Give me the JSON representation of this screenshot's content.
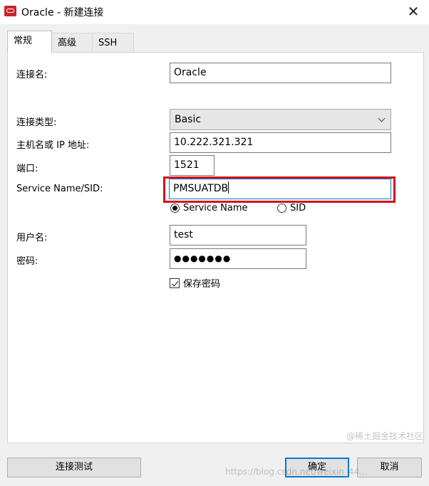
{
  "window": {
    "title": "Oracle - 新建连接",
    "close_glyph": "✕"
  },
  "tabs": [
    {
      "label": "常规",
      "active": true
    },
    {
      "label": "高级",
      "active": false
    },
    {
      "label": "SSH",
      "active": false
    }
  ],
  "form": {
    "connection_name": {
      "label": "连接名:",
      "value": "Oracle"
    },
    "connection_type": {
      "label": "连接类型:",
      "value": "Basic"
    },
    "host": {
      "label": "主机名或 IP 地址:",
      "value": "10.222.321.321"
    },
    "port": {
      "label": "端口:",
      "value": "1521"
    },
    "service": {
      "label": "Service Name/SID:",
      "value": "PMSUATDB"
    },
    "service_type": {
      "options": [
        "Service Name",
        "SID"
      ],
      "selected": "Service Name"
    },
    "username": {
      "label": "用户名:",
      "value": "test"
    },
    "password": {
      "label": "密码:",
      "value": "●●●●●●●"
    },
    "save_password": {
      "label": "保存密码",
      "checked": true
    }
  },
  "buttons": {
    "test": "连接测试",
    "ok": "确定",
    "cancel": "取消"
  },
  "watermark": {
    "url": "https://blog.csdn.net/weixin_44...",
    "community": "@稀土掘金技术社区"
  },
  "colors": {
    "highlight": "#d1121a",
    "oracle_red": "#c9252d",
    "focus_blue": "#0078d7"
  }
}
